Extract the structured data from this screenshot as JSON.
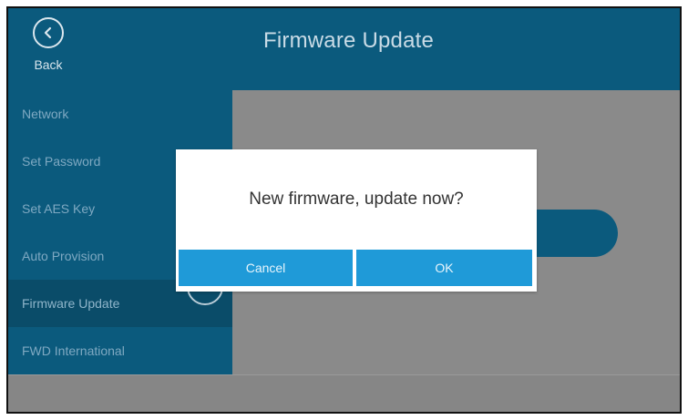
{
  "header": {
    "back_label": "Back",
    "title": "Firmware Update"
  },
  "sidebar": {
    "items": [
      {
        "label": "Network"
      },
      {
        "label": "Set Password"
      },
      {
        "label": "Set AES Key"
      },
      {
        "label": "Auto Provision"
      },
      {
        "label": "Firmware Update",
        "active": true
      },
      {
        "label": "FWD International"
      }
    ]
  },
  "dialog": {
    "message": "New firmware, update now?",
    "cancel_label": "Cancel",
    "ok_label": "OK"
  },
  "colors": {
    "header_bg": "#0b5a7d",
    "active_item_bg": "#0a4c69",
    "overlay_gray": "#8a8a8a",
    "dialog_button": "#1f9ad8"
  },
  "icons": {
    "back": "chevron-left-circle-icon",
    "scroll": "chevron-down-circle-icon"
  }
}
